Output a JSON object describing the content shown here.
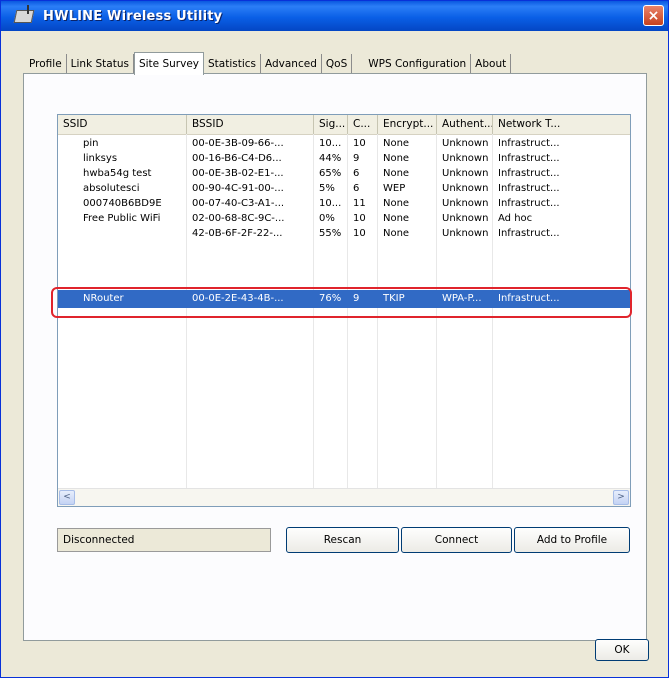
{
  "window": {
    "title": "HWLINE Wireless Utility",
    "close_label": "×"
  },
  "tabs": [
    {
      "label": "Profile"
    },
    {
      "label": "Link Status"
    },
    {
      "label": "Site Survey"
    },
    {
      "label": "Statistics"
    },
    {
      "label": "Advanced"
    },
    {
      "label": "QoS"
    },
    {
      "label": "WPS Configuration"
    },
    {
      "label": "About"
    }
  ],
  "active_tab": "Site Survey",
  "table": {
    "columns": [
      "SSID",
      "BSSID",
      "Sig...",
      "C...",
      "Encrypt...",
      "Authent...",
      "Network T..."
    ],
    "rows": [
      {
        "ssid": "pin",
        "bssid": "00-0E-3B-09-66-...",
        "signal": "10...",
        "channel": "10",
        "encryption": "None",
        "auth": "Unknown",
        "network": "Infrastruct..."
      },
      {
        "ssid": "linksys",
        "bssid": "00-16-B6-C4-D6...",
        "signal": "44%",
        "channel": "9",
        "encryption": "None",
        "auth": "Unknown",
        "network": "Infrastruct..."
      },
      {
        "ssid": "hwba54g test",
        "bssid": "00-0E-3B-02-E1-...",
        "signal": "65%",
        "channel": "6",
        "encryption": "None",
        "auth": "Unknown",
        "network": "Infrastruct..."
      },
      {
        "ssid": "absolutesci",
        "bssid": "00-90-4C-91-00-...",
        "signal": "5%",
        "channel": "6",
        "encryption": "WEP",
        "auth": "Unknown",
        "network": "Infrastruct..."
      },
      {
        "ssid": "000740B6BD9E",
        "bssid": "00-07-40-C3-A1-...",
        "signal": "10...",
        "channel": "11",
        "encryption": "None",
        "auth": "Unknown",
        "network": "Infrastruct..."
      },
      {
        "ssid": "Free Public WiFi",
        "bssid": "02-00-68-8C-9C-...",
        "signal": "0%",
        "channel": "10",
        "encryption": "None",
        "auth": "Unknown",
        "network": "Ad hoc"
      },
      {
        "ssid": "",
        "bssid": "42-0B-6F-2F-22-...",
        "signal": "55%",
        "channel": "10",
        "encryption": "None",
        "auth": "Unknown",
        "network": "Infrastruct..."
      }
    ],
    "selected_row": {
      "ssid": "NRouter",
      "bssid": "00-0E-2E-43-4B-...",
      "signal": "76%",
      "channel": "9",
      "encryption": "TKIP",
      "auth": "WPA-P...",
      "network": "Infrastruct..."
    },
    "scroll_left_icon": "<",
    "scroll_right_icon": ">"
  },
  "status": {
    "text": "Disconnected"
  },
  "buttons": {
    "rescan": "Rescan",
    "connect": "Connect",
    "add_to_profile": "Add to Profile",
    "ok": "OK"
  },
  "colors": {
    "selection": "#316ac5",
    "highlight_outline": "#e0242c",
    "titlebar": "#0a58e0"
  }
}
